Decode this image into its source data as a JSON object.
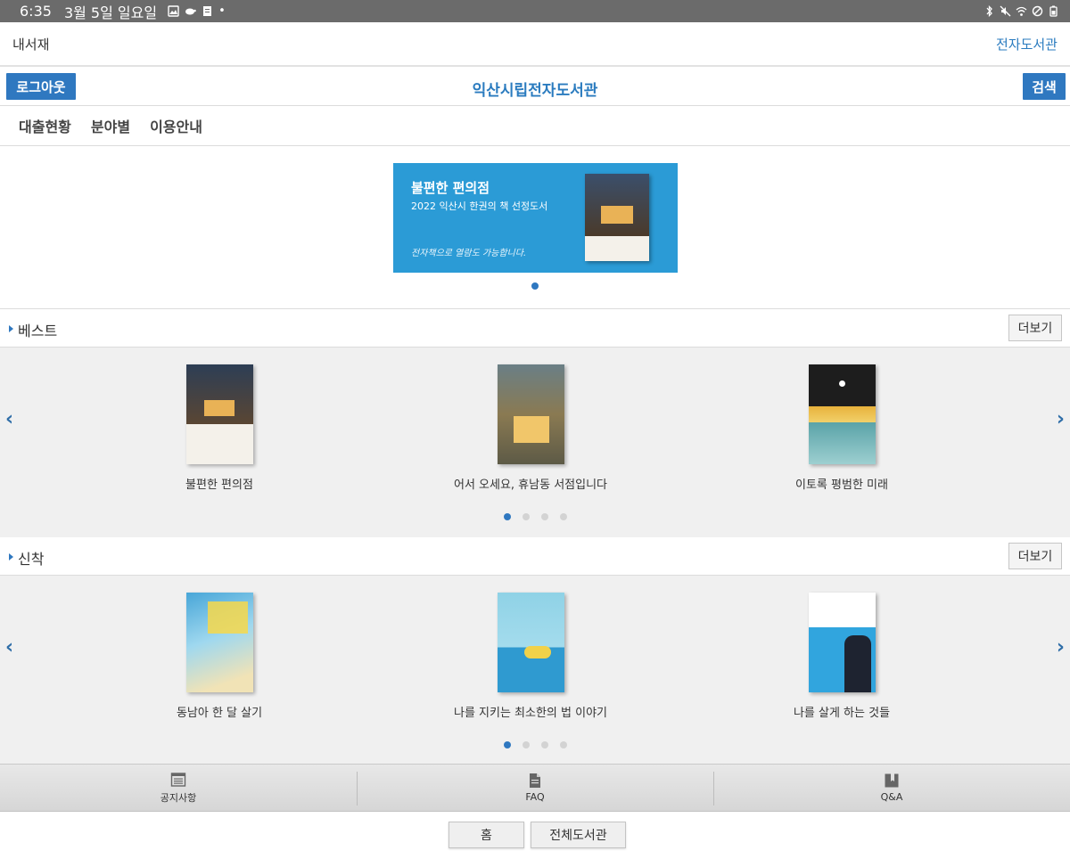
{
  "status_bar": {
    "time": "6:35",
    "date": "3월 5일 일요일",
    "dot": "•"
  },
  "appbar": {
    "left_label": "내서재",
    "right_label": "전자도서관"
  },
  "titlebar": {
    "logout_label": "로그아웃",
    "title": "익산시립전자도서관",
    "search_label": "검색"
  },
  "menu": {
    "items": [
      "대출현황",
      "분야별",
      "이용안내"
    ]
  },
  "banner": {
    "title": "불편한 편의점",
    "subtitle": "2022 익산시 한권의 책 선정도서",
    "note": "전자책으로 열람도 가능합니다."
  },
  "best": {
    "title": "베스트",
    "more_label": "더보기",
    "books": [
      {
        "title": "불편한 편의점"
      },
      {
        "title": "어서 오세요, 휴남동 서점입니다"
      },
      {
        "title": "이토록 평범한 미래"
      }
    ],
    "page": 1,
    "page_count": 4
  },
  "new": {
    "title": "신착",
    "more_label": "더보기",
    "books": [
      {
        "title": "동남아 한 달 살기"
      },
      {
        "title": "나를 지키는 최소한의 법 이야기"
      },
      {
        "title": "나를 살게 하는 것들"
      }
    ],
    "page": 1,
    "page_count": 4
  },
  "tabs": {
    "items": [
      {
        "label": "공지사항",
        "icon": "notice-icon"
      },
      {
        "label": "FAQ",
        "icon": "document-icon"
      },
      {
        "label": "Q&A",
        "icon": "book-icon"
      }
    ]
  },
  "footer": {
    "home_label": "홈",
    "all_label": "전체도서관"
  },
  "colors": {
    "accent": "#2f78c0",
    "title_blue": "#2a7bbf",
    "banner_bg": "#2b9bd6",
    "status_bar": "#6b6b6b"
  }
}
